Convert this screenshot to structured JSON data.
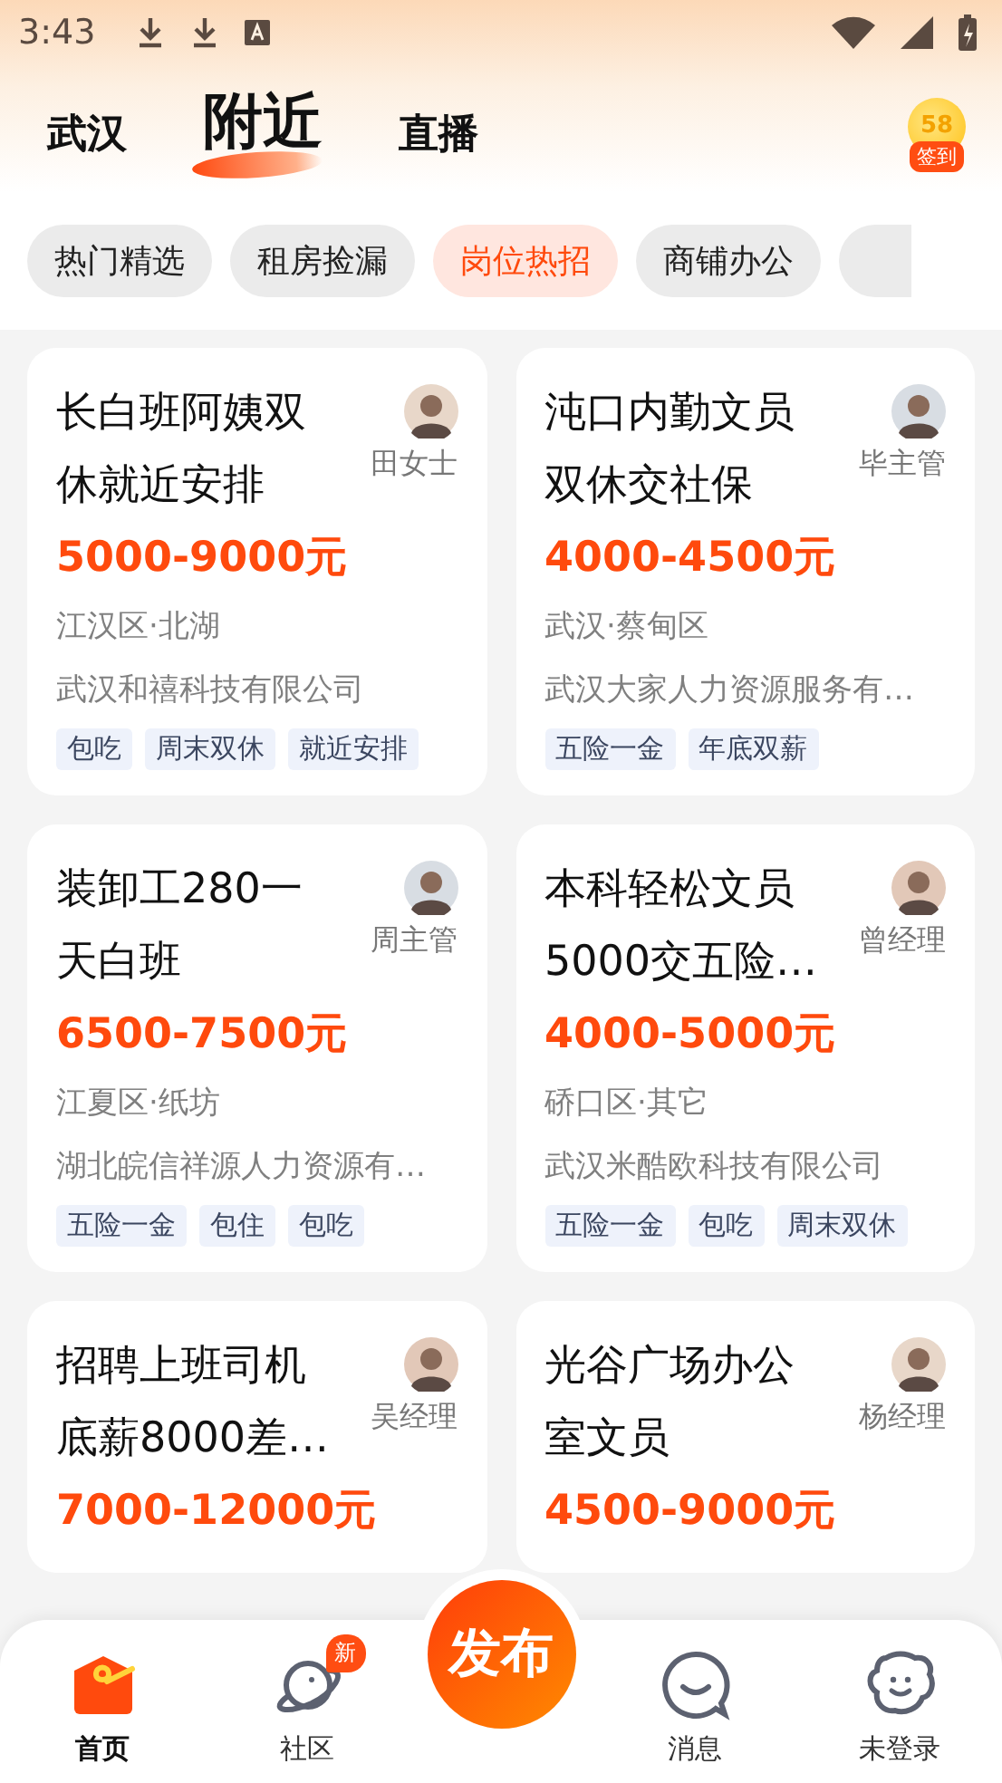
{
  "status_bar": {
    "time": "3:43"
  },
  "top_tabs": [
    {
      "label": "武汉",
      "selected": false
    },
    {
      "label": "附近",
      "selected": true
    },
    {
      "label": "直播",
      "selected": false
    }
  ],
  "checkin": {
    "coin_text": "58",
    "label": "签到"
  },
  "categories": [
    {
      "label": "热门精选",
      "selected": false
    },
    {
      "label": "租房捡漏",
      "selected": false
    },
    {
      "label": "岗位热招",
      "selected": true
    },
    {
      "label": "商铺办公",
      "selected": false
    }
  ],
  "columns": [
    [
      {
        "title_lines": [
          "长白班阿姨双",
          "休就近安排"
        ],
        "contact": "田女士",
        "salary": "5000-9000元",
        "location": "江汉区·北湖",
        "company": "武汉和禧科技有限公司",
        "tags": [
          "包吃",
          "周末双休",
          "就近安排"
        ]
      },
      {
        "title_lines": [
          "装卸工280一",
          "天白班"
        ],
        "contact": "周主管",
        "salary": "6500-7500元",
        "location": "江夏区·纸坊",
        "company": "湖北皖信祥源人力资源有…",
        "tags": [
          "五险一金",
          "包住",
          "包吃"
        ]
      },
      {
        "title_lines": [
          "招聘上班司机",
          "底薪8000差…"
        ],
        "contact": "吴经理",
        "salary": "7000-12000元"
      }
    ],
    [
      {
        "title_lines": [
          "沌口内勤文员",
          "双休交社保"
        ],
        "contact": "毕主管",
        "salary": "4000-4500元",
        "location": "武汉·蔡甸区",
        "company": "武汉大家人力资源服务有…",
        "tags": [
          "五险一金",
          "年底双薪"
        ]
      },
      {
        "title_lines": [
          "本科轻松文员",
          "5000交五险…"
        ],
        "contact": "曾经理",
        "salary": "4000-5000元",
        "location": "硚口区·其它",
        "company": "武汉米酷欧科技有限公司",
        "tags": [
          "五险一金",
          "包吃",
          "周末双休"
        ]
      },
      {
        "title_lines": [
          "光谷广场办公",
          "室文员"
        ],
        "contact": "杨经理",
        "salary": "4500-9000元"
      }
    ]
  ],
  "publish_button": {
    "label": "发布"
  },
  "bottom_nav": [
    {
      "kind": "home",
      "label": "首页",
      "selected": true
    },
    {
      "kind": "community",
      "label": "社区",
      "selected": false,
      "badge": "新"
    },
    {
      "kind": "publish"
    },
    {
      "kind": "messages",
      "label": "消息",
      "selected": false
    },
    {
      "kind": "profile",
      "label": "未登录",
      "selected": false
    }
  ]
}
